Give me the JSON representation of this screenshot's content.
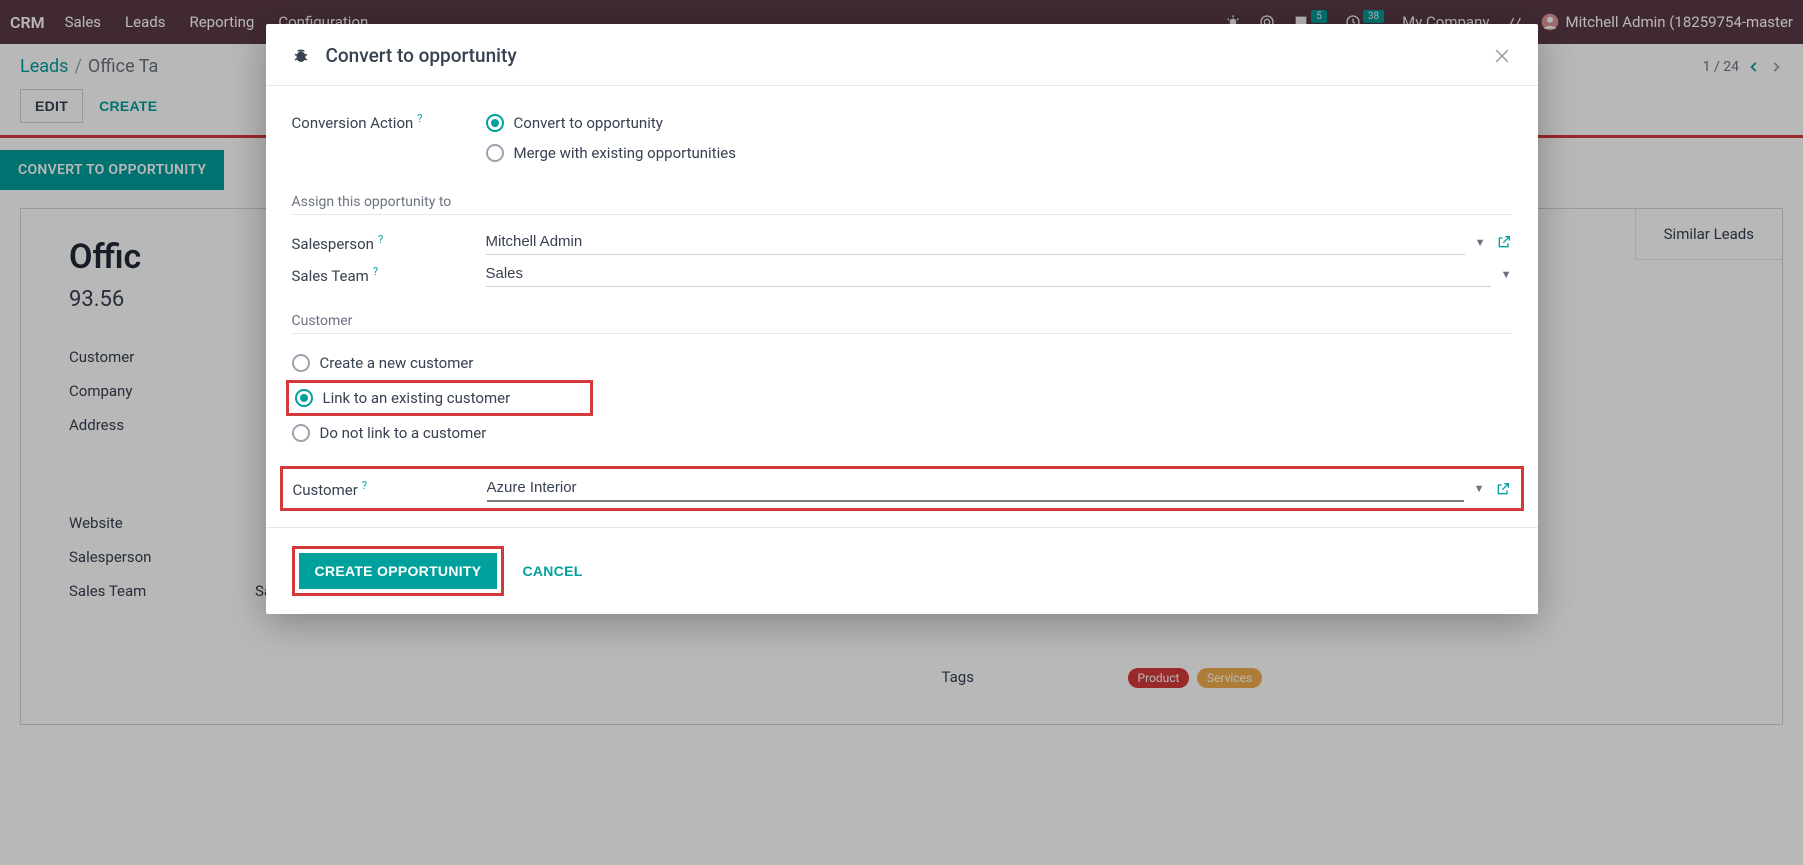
{
  "topnav": {
    "brand": "CRM",
    "items": [
      "Sales",
      "Leads",
      "Reporting",
      "Configuration"
    ],
    "msg_badge": "5",
    "clock_badge": "38",
    "company": "My Company",
    "user": "Mitchell Admin (18259754-master"
  },
  "breadcrumb": {
    "root": "Leads",
    "current": "Office Ta",
    "pager": "1 / 24"
  },
  "actions": {
    "edit": "EDIT",
    "create": "CREATE",
    "convert": "CONVERT TO OPPORTUNITY"
  },
  "sheet": {
    "similar": "Similar Leads",
    "title": "Offic",
    "probability": "93.56",
    "fields": {
      "customer_lbl": "Customer",
      "company_lbl": "Company",
      "address_lbl": "Address",
      "website_lbl": "Website",
      "salesperson_lbl": "Salesperson",
      "salesteam_lbl": "Sales Team",
      "salesteam_val": "Sales",
      "tags_lbl": "Tags",
      "tag1": "Product",
      "tag2": "Services"
    }
  },
  "modal": {
    "title": "Convert to opportunity",
    "conv_action_lbl": "Conversion Action",
    "opt_convert": "Convert to opportunity",
    "opt_merge": "Merge with existing opportunities",
    "assign_section": "Assign this opportunity to",
    "salesperson_lbl": "Salesperson",
    "salesperson_val": "Mitchell Admin",
    "salesteam_lbl": "Sales Team",
    "salesteam_val": "Sales",
    "customer_section": "Customer",
    "opt_new_cust": "Create a new customer",
    "opt_link_cust": "Link to an existing customer",
    "opt_no_cust": "Do not link to a customer",
    "customer_lbl": "Customer",
    "customer_val": "Azure Interior",
    "btn_create": "CREATE OPPORTUNITY",
    "btn_cancel": "CANCEL"
  }
}
